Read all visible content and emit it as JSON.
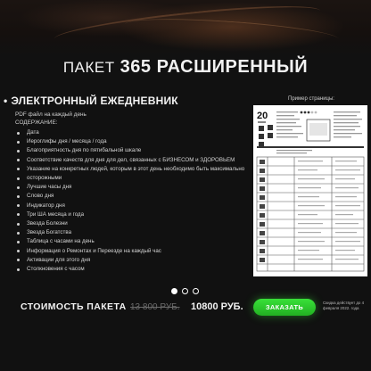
{
  "header": {
    "title_prefix": "ПАКЕТ",
    "title_main": "365 РАСШИРЕННЫЙ"
  },
  "section": {
    "title": "ЭЛЕКТРОННЫЙ ЕЖЕДНЕВНИК",
    "description": "PDF файл на каждый день",
    "contents_label": "СОДЕРЖАНИЕ:",
    "items": [
      "Дата",
      "Иероглифы дня / месяца / года",
      "Благоприятность дня по пятибальной шкале",
      "Соответствие качеств для дня для дел, связанных с БИЗНЕСОМ и ЗДОРОВЬЕМ",
      "Указание на конкретных людей, которым в этот день необходимо быть максимально",
      "осторожными",
      "Лучшие часы дня",
      "Слово дня",
      "Индикатор дня",
      "Три ША месяца и года",
      "Звезда Болезни",
      "Звезда Богатства",
      "Таблица с часами на день",
      "Информация о Ремонтах и Переезде на каждый час",
      "Активации для этого дня",
      "Столкновения с часом"
    ]
  },
  "example": {
    "label": "Пример страницы:",
    "day_number": "20"
  },
  "carousel": {
    "count": 3,
    "active_index": 0
  },
  "pricing": {
    "label": "СТОИМОСТЬ ПАКЕТА",
    "old_price": "13 800 РУБ.",
    "new_price": "10800 РУБ.",
    "order_button": "ЗАКАЗАТЬ",
    "until_note": "Скидка действует до 4 февраля 2022. года"
  },
  "colors": {
    "background": "#111111",
    "accent_green": "#2ecc2e",
    "text": "#f2f2f2",
    "muted": "#6b6b6b"
  }
}
